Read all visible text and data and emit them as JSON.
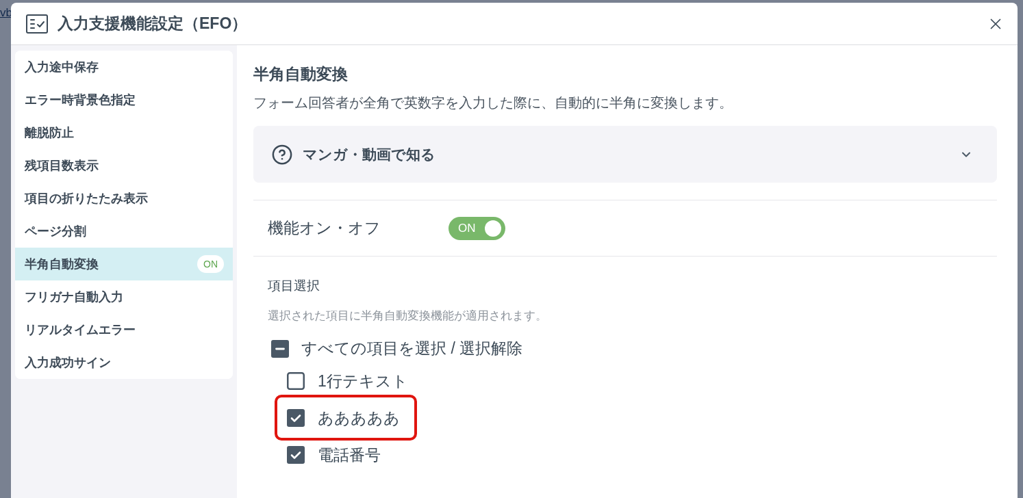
{
  "backdrop": {
    "link_fragment": "vb"
  },
  "dialog": {
    "title": "入力支援機能設定（EFO）"
  },
  "sidebar": {
    "items": [
      {
        "label": "入力途中保存",
        "selected": false
      },
      {
        "label": "エラー時背景色指定",
        "selected": false
      },
      {
        "label": "離脱防止",
        "selected": false
      },
      {
        "label": "残項目数表示",
        "selected": false
      },
      {
        "label": "項目の折りたたみ表示",
        "selected": false
      },
      {
        "label": "ページ分割",
        "selected": false
      },
      {
        "label": "半角自動変換",
        "selected": true,
        "badge": "ON"
      },
      {
        "label": "フリガナ自動入力",
        "selected": false
      },
      {
        "label": "リアルタイムエラー",
        "selected": false
      },
      {
        "label": "入力成功サイン",
        "selected": false
      }
    ]
  },
  "feature": {
    "title": "半角自動変換",
    "description": "フォーム回答者が全角で英数字を入力した際に、自動的に半角に変換します。"
  },
  "help_accordion": {
    "label": "マンガ・動画で知る",
    "expanded": false
  },
  "toggle_row": {
    "label": "機能オン・オフ",
    "on": true,
    "state_text": "ON"
  },
  "field_selection": {
    "title": "項目選択",
    "hint": "選択された項目に半角自動変換機能が適用されます。",
    "select_all": {
      "label": "すべての項目を選択 / 選択解除",
      "indeterminate": true
    },
    "fields": [
      {
        "label": "1行テキスト",
        "checked": false,
        "highlighted": false
      },
      {
        "label": "あああああ",
        "checked": true,
        "highlighted": true
      },
      {
        "label": "電話番号",
        "checked": true,
        "highlighted": false
      }
    ]
  }
}
